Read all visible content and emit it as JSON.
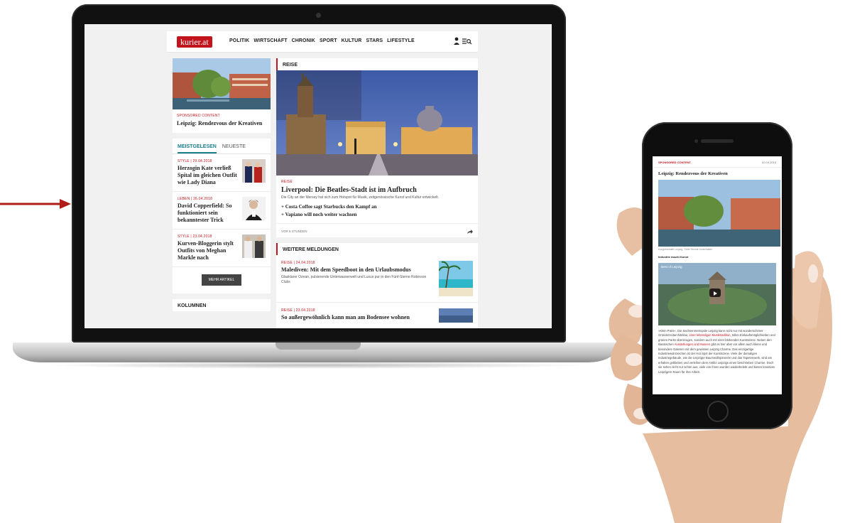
{
  "site": {
    "logo": "kurier.at",
    "nav": [
      "POLITIK",
      "WIRTSCHAFT",
      "CHRONIK",
      "SPORT",
      "KULTUR",
      "STARS",
      "LIFESTYLE"
    ]
  },
  "sidebar": {
    "sponsored": {
      "kicker": "SPONSORED CONTENT",
      "title": "Leipzig: Rendezvous der Kreativen"
    },
    "tabs": [
      "MEISTGELESEN",
      "NEUESTE"
    ],
    "most_read": [
      {
        "kicker": "STYLE | 29.04.2018",
        "title": "Herzogin Kate verließ Spital im gleichen Outfit wie Lady Diana"
      },
      {
        "kicker": "LEBEN | 26.04.2018",
        "title": "David Copperfield: So funktioniert sein bekanntester Trick"
      },
      {
        "kicker": "STYLE | 23.04.2018",
        "title": "Kurven-Bloggerin stylt Outfits von Meghan Markle nach"
      }
    ],
    "more_button": "MEHR ARTIKEL",
    "columns_heading": "KOLUMNEN"
  },
  "main": {
    "section": "REISE",
    "lead": {
      "kicker": "REISE",
      "title": "Liverpool: Die Beatles-Stadt ist im Aufbruch",
      "teaser": "Die City an der Mersey hat sich zum Hotspot für Musik, zeitgenössische Kunst und Kultur entwickelt.",
      "related": [
        "+ Costa Coffee sagt Starbucks den Kampf an",
        "+ Vapiano will noch weiter wachsen"
      ],
      "time": "VOR 5 STUNDEN"
    },
    "more_heading": "WEITERE MELDUNGEN",
    "items": [
      {
        "kicker": "REISE | 24.04.2018",
        "title": "Malediven: Mit dem Speedboot in den Urlaubsmodus",
        "teaser": "Glasklarer Ozean, pulsierende Unterwasserwelt und Luxus pur in den Fünf-Sterne Robinson Clubs"
      },
      {
        "kicker": "REISE | 23.04.2018",
        "title": "So außergewöhnlich kann man am Bodensee wohnen",
        "teaser": ""
      }
    ]
  },
  "phone": {
    "kicker": "SPONSORED CONTENT",
    "date": "00.04.2018",
    "title": "Leipzig: Rendezvous der Kreativen",
    "caption": "Kongresshalle Leipzig, ©Alle Rechte Vorbehalten",
    "subheading": "Industrie macht Kunst",
    "video_title": "Best of Leipzig",
    "body_start": "»Klein Paris«. Die Sachsenmetropole Leipzig kann nicht nur mit wunderschöner Gründerzeitarchitektur,",
    "body_link1": "einer lebendigen Musiktradition",
    "body_mid": ", tollen Einkaufsmöglichkeiten und grünen Parks überzeugen, sondern auch mit einer blühenden Kunstszene. Neben den klassischen",
    "body_link2": "Ausstellungen und Museen",
    "body_end": "gibt es hier aber vor allem auch kleine und besondere Galerien mit dem gewissen Leipzig Charme. Das einzigartige Industriewahrzeichen ist der Hot Spot der Kunstszene. Viele der damaligen Industriegebäude, wie die Leipziger Baumwollspinnerei und das Tapetenwerk, sind am erhalten geblieben und verleihen dem Antlitz Leipzigs einen beschrieben Charme. Doch sie sehen nicht nur schön aus, viele von ihnen wurden wiederbelebt und bieten kreativen Leipzigern Raum für ihre Arbeit."
  },
  "colors": {
    "brand_red": "#c3141c",
    "tab_teal": "#1b7f8c"
  }
}
